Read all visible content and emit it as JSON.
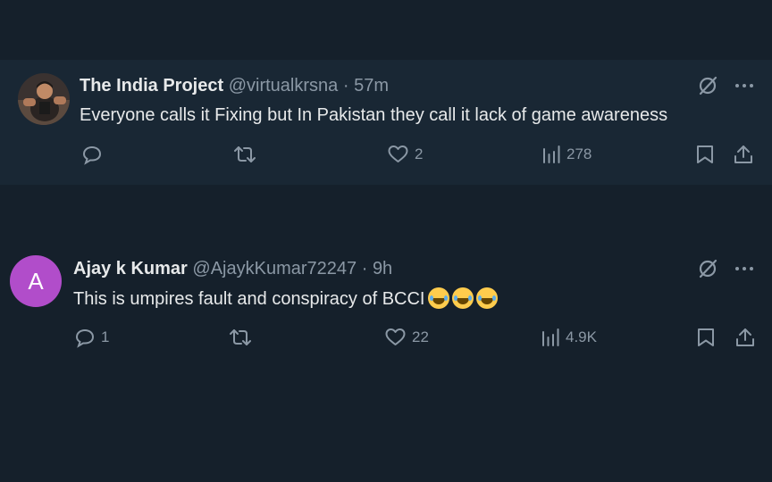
{
  "tweets": [
    {
      "name": "The India Project",
      "handle": "@virtualkrsna",
      "separator": "·",
      "time": "57m",
      "text": "Everyone calls it Fixing but In Pakistan they call it lack of game awareness",
      "emoji_count": 0,
      "avatar": {
        "type": "photo",
        "icon": "profile-photo"
      },
      "stats": {
        "replies": "",
        "retweets": "",
        "likes": "2",
        "views": "278"
      }
    },
    {
      "name": "Ajay k Kumar",
      "handle": "@AjaykKumar72247",
      "separator": "·",
      "time": "9h",
      "text": "This is umpires fault and conspiracy of BCCI",
      "emoji_count": 3,
      "emoji_name": "face-with-tears-of-joy",
      "avatar": {
        "type": "letter",
        "letter": "A",
        "color": "#b14dca"
      },
      "stats": {
        "replies": "1",
        "retweets": "",
        "likes": "22",
        "views": "4.9K"
      }
    }
  ],
  "colors": {
    "background": "#15202b",
    "highlight": "#192734",
    "text": "#e7e9ea",
    "muted": "#8b98a5"
  },
  "icons": [
    "grok-icon",
    "more-icon",
    "reply-icon",
    "retweet-icon",
    "like-icon",
    "views-icon",
    "bookmark-icon",
    "share-icon"
  ]
}
